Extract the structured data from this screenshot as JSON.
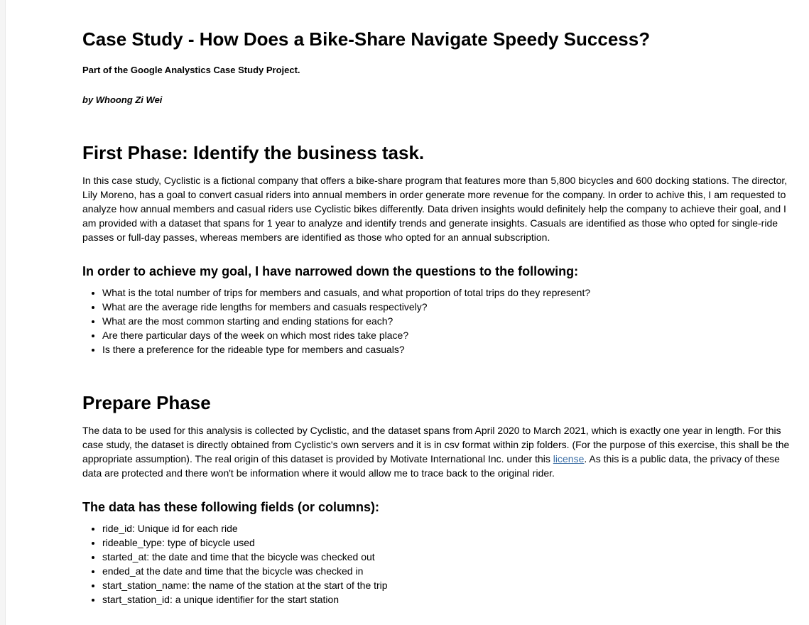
{
  "header": {
    "title": "Case Study - How Does a Bike-Share Navigate Speedy Success?",
    "subtitle": "Part of the Google Analystics Case Study Project.",
    "author": "by Whoong Zi Wei"
  },
  "phase1": {
    "heading": "First Phase: Identify the business task.",
    "paragraph": "In this case study, Cyclistic is a fictional company that offers a bike-share program that features more than 5,800 bicycles and 600 docking stations. The director, Lily Moreno, has a goal to convert casual riders into annual members in order generate more revenue for the company. In order to achive this, I am requested to analyze how annual members and casual riders use Cyclistic bikes differently. Data driven insights would definitely help the company to achieve their goal, and I am provided with a dataset that spans for 1 year to analyze and identify trends and generate insights. Casuals are identified as those who opted for single-ride passes or full-day passes, whereas members are identified as those who opted for an annual subscription.",
    "questions_heading": "In order to achieve my goal, I have narrowed down the questions to the following:",
    "questions": [
      "What is the total number of trips for members and casuals, and what proportion of total trips do they represent?",
      "What are the average ride lengths for members and casuals respectively?",
      "What are the most common starting and ending stations for each?",
      "Are there particular days of the week on which most rides take place?",
      "Is there a preference for the rideable type for members and casuals?"
    ]
  },
  "phase2": {
    "heading": "Prepare Phase",
    "paragraph_before_link": "The data to be used for this analysis is collected by Cyclistic, and the dataset spans from April 2020 to March 2021, which is exactly one year in length. For this case study, the dataset is directly obtained from Cyclistic's own servers and it is in csv format within zip folders. (For the purpose of this exercise, this shall be the appropriate assumption). The real origin of this dataset is provided by Motivate International Inc. under this ",
    "link_text": "license",
    "paragraph_after_link": ". As this is a public data, the privacy of these data are protected and there won't be information where it would allow me to trace back to the original rider.",
    "fields_heading": "The data has these following fields (or columns):",
    "fields": [
      "ride_id: Unique id for each ride",
      "rideable_type: type of bicycle used",
      "started_at: the date and time that the bicycle was checked out",
      "ended_at the date and time that the bicycle was checked in",
      "start_station_name: the name of the station at the start of the trip",
      "start_station_id: a unique identifier for the start station"
    ]
  },
  "colors": {
    "link": "#3b6ea5",
    "text": "#000000",
    "background": "#ffffff"
  }
}
